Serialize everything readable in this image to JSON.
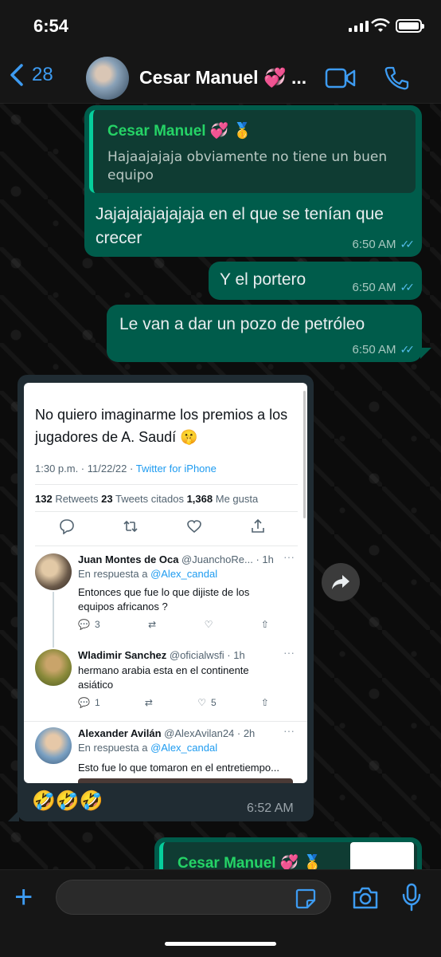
{
  "status_bar": {
    "time": "6:54"
  },
  "header": {
    "back_count": "28",
    "contact_name": "Cesar Manuel 💞 ...",
    "icons": [
      "chevron-left-icon",
      "video-call-icon",
      "phone-icon"
    ]
  },
  "messages": [
    {
      "quote_author": "Cesar Manuel 💞 🥇",
      "quote_text": "Hajaajajaja obviamente no tiene un buen equipo",
      "text": "Jajajajajajajaja en el que se tenían que crecer",
      "time": "6:50 AM"
    },
    {
      "text": "Y el portero",
      "time": "6:50 AM"
    },
    {
      "text": "Le van a dar un pozo de petróleo",
      "time": "6:50 AM"
    }
  ],
  "tweet": {
    "text": "No quiero imaginarme los premios a los jugadores de A. Saudí 🤫",
    "date": "1:30 p.m. · 11/22/22 · ",
    "source": "Twitter for iPhone",
    "retweets": "132",
    "retweets_label": " Retweets ",
    "quotes": "23",
    "quotes_label": " Tweets citados ",
    "likes": "1,368",
    "likes_label": " Me gusta",
    "replies": [
      {
        "name": "Juan Montes de Oca",
        "handle": "@JuanchoRe... · 1h",
        "reply_to": "En respuesta a ",
        "reply_handle": "@Alex_candal",
        "text": "Entonces que fue lo que dijiste de los equipos africanos ?",
        "reply_count": "3",
        "retweet_count": "",
        "like_count": ""
      },
      {
        "name": "Wladimir Sanchez",
        "handle": "@oficialwsfi · 1h",
        "text": "hermano arabia esta en el continente asiático",
        "reply_count": "1",
        "retweet_count": "",
        "like_count": "5"
      },
      {
        "name": "Alexander Avilán",
        "handle": "@AlexAvilan24 · 2h",
        "reply_to": "En respuesta a ",
        "reply_handle": "@Alex_candal",
        "text": "Esto fue lo que tomaron en el entretiempo..."
      }
    ]
  },
  "incoming": {
    "caption": "🤣🤣🤣",
    "time": "6:52 AM"
  },
  "partial_quote_author": "Cesar Manuel 💞 🥇",
  "input": {
    "placeholder": ""
  },
  "colors": {
    "accent": "#3d9bf1",
    "outgoing": "#005c4b",
    "incoming": "#202c33",
    "quote_name": "#25d366",
    "read_ticks": "#53bdeb"
  }
}
